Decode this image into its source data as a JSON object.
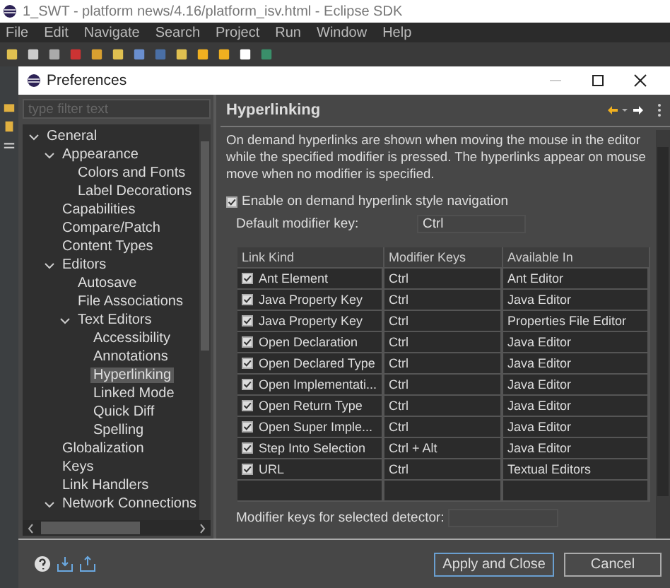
{
  "window": {
    "title": "1_SWT - platform news/4.16/platform_isv.html - Eclipse SDK"
  },
  "menu": [
    "File",
    "Edit",
    "Navigate",
    "Search",
    "Project",
    "Run",
    "Window",
    "Help"
  ],
  "dialog": {
    "title": "Preferences",
    "filter": {
      "placeholder": "type filter text"
    },
    "tree": [
      {
        "label": "General",
        "expanded": true,
        "selected": false,
        "children": [
          {
            "label": "Appearance",
            "expanded": true,
            "selected": false,
            "children": [
              {
                "label": "Colors and Fonts",
                "selected": false
              },
              {
                "label": "Label Decorations",
                "selected": false
              }
            ]
          },
          {
            "label": "Capabilities",
            "selected": false
          },
          {
            "label": "Compare/Patch",
            "selected": false
          },
          {
            "label": "Content Types",
            "selected": false
          },
          {
            "label": "Editors",
            "expanded": true,
            "selected": false,
            "children": [
              {
                "label": "Autosave",
                "selected": false
              },
              {
                "label": "File Associations",
                "selected": false
              },
              {
                "label": "Text Editors",
                "expanded": true,
                "selected": false,
                "children": [
                  {
                    "label": "Accessibility",
                    "selected": false
                  },
                  {
                    "label": "Annotations",
                    "selected": false
                  },
                  {
                    "label": "Hyperlinking",
                    "selected": true
                  },
                  {
                    "label": "Linked Mode",
                    "selected": false
                  },
                  {
                    "label": "Quick Diff",
                    "selected": false
                  },
                  {
                    "label": "Spelling",
                    "selected": false
                  }
                ]
              }
            ]
          },
          {
            "label": "Globalization",
            "selected": false
          },
          {
            "label": "Keys",
            "selected": false
          },
          {
            "label": "Link Handlers",
            "selected": false
          },
          {
            "label": "Network Connections",
            "expanded": true,
            "selected": false
          }
        ]
      }
    ],
    "page": {
      "title": "Hyperlinking",
      "description": "On demand hyperlinks are shown when moving the mouse in the editor while the specified modifier is pressed. The hyperlinks appear on mouse move when no modifier is specified.",
      "enable": {
        "label": "Enable on demand hyperlink style navigation",
        "checked": true
      },
      "default_modifier": {
        "label": "Default modifier key:",
        "value": "Ctrl"
      },
      "table": {
        "columns": [
          "Link Kind",
          "Modifier Keys",
          "Available In"
        ],
        "rows": [
          {
            "checked": true,
            "kind": "Ant Element",
            "keys": "Ctrl",
            "available": "Ant Editor"
          },
          {
            "checked": true,
            "kind": "Java Property Key",
            "keys": "Ctrl",
            "available": "Java Editor"
          },
          {
            "checked": true,
            "kind": "Java Property Key",
            "keys": "Ctrl",
            "available": "Properties File Editor"
          },
          {
            "checked": true,
            "kind": "Open Declaration",
            "keys": "Ctrl",
            "available": "Java Editor"
          },
          {
            "checked": true,
            "kind": "Open Declared Type",
            "keys": "Ctrl",
            "available": "Java Editor"
          },
          {
            "checked": true,
            "kind": "Open Implementati...",
            "keys": "Ctrl",
            "available": "Java Editor"
          },
          {
            "checked": true,
            "kind": "Open Return Type",
            "keys": "Ctrl",
            "available": "Java Editor"
          },
          {
            "checked": true,
            "kind": "Open Super Imple...",
            "keys": "Ctrl",
            "available": "Java Editor"
          },
          {
            "checked": true,
            "kind": "Step Into Selection",
            "keys": "Ctrl + Alt",
            "available": "Java Editor"
          },
          {
            "checked": true,
            "kind": "URL",
            "keys": "Ctrl",
            "available": "Textual Editors"
          }
        ]
      },
      "selected_modifier": {
        "label": "Modifier keys for selected detector:"
      }
    },
    "buttons": [
      "Apply and Close",
      "Cancel"
    ]
  }
}
